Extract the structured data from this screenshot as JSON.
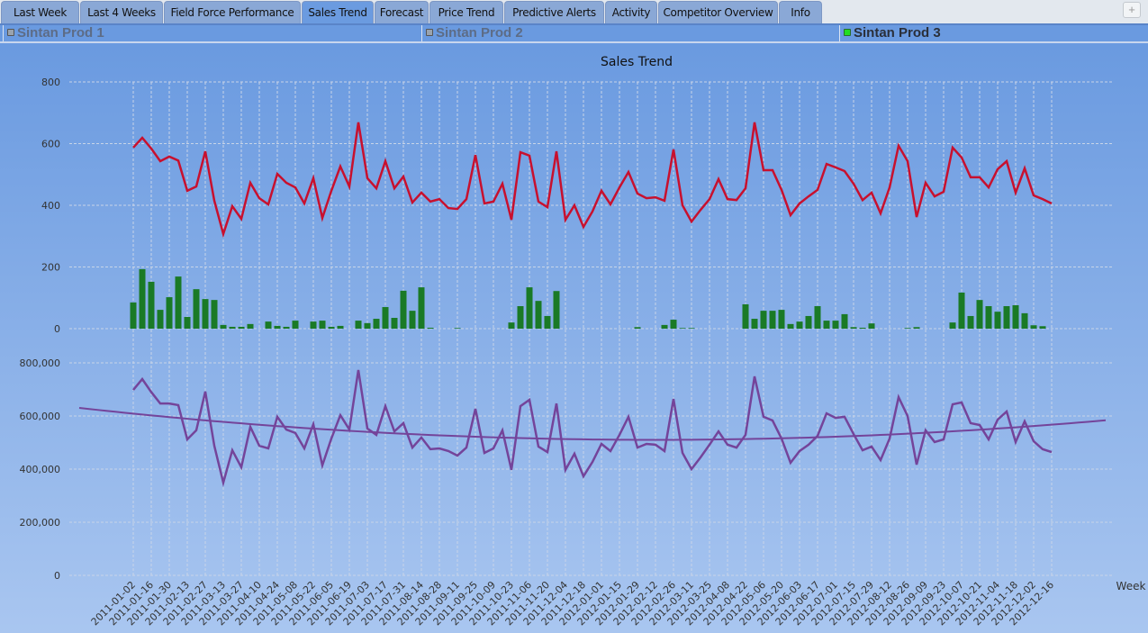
{
  "tabs": [
    {
      "label": "Last Week",
      "active": false
    },
    {
      "label": "Last 4 Weeks",
      "active": false
    },
    {
      "label": "Field Force Performance",
      "active": false
    },
    {
      "label": "Sales Trend",
      "active": true
    },
    {
      "label": "Forecast",
      "active": false
    },
    {
      "label": "Price Trend",
      "active": false
    },
    {
      "label": "Predictive Alerts",
      "active": false
    },
    {
      "label": "Activity",
      "active": false
    },
    {
      "label": "Competitor Overview",
      "active": false
    },
    {
      "label": "Info",
      "active": false
    }
  ],
  "add_tab_label": "+",
  "products": [
    {
      "label": "Sintan Prod 1",
      "selected": false
    },
    {
      "label": "Sintan Prod 2",
      "selected": false
    },
    {
      "label": "Sintan Prod 3",
      "selected": true
    }
  ],
  "colors": {
    "red_series": "#c8102e",
    "bar_series": "#1a7a26",
    "purple_series": "#74449a",
    "selected_indicator": "#22dd22"
  },
  "chart_data": [
    {
      "type": "line+bar",
      "title": "Sales Trend",
      "ylim": [
        0,
        800
      ],
      "yticks": [
        0,
        200,
        400,
        600,
        800
      ],
      "grid": true,
      "x_start": "2011-01-02",
      "x_interval_days": 7,
      "series": [
        {
          "name": "units-line",
          "type": "line",
          "color": "#c8102e",
          "values": [
            587,
            619,
            584,
            543,
            558,
            545,
            447,
            461,
            575,
            415,
            307,
            397,
            356,
            473,
            423,
            403,
            502,
            473,
            458,
            406,
            488,
            359,
            447,
            526,
            461,
            669,
            488,
            455,
            543,
            455,
            493,
            409,
            441,
            412,
            420,
            391,
            388,
            420,
            563,
            406,
            412,
            470,
            353,
            572,
            561,
            412,
            394,
            575,
            353,
            400,
            330,
            380,
            447,
            403,
            458,
            508,
            438,
            423,
            426,
            415,
            581,
            400,
            347,
            385,
            420,
            485,
            420,
            417,
            455,
            669,
            514,
            514,
            450,
            368,
            406,
            429,
            450,
            534,
            523,
            511,
            470,
            417,
            441,
            374,
            458,
            593,
            543,
            362,
            473,
            429,
            444,
            587,
            555,
            491,
            491,
            458,
            517,
            543,
            441,
            520,
            432,
            420,
            406
          ]
        },
        {
          "name": "units-bars",
          "type": "bar",
          "color": "#1a7a26",
          "values": [
            85,
            193,
            152,
            61,
            102,
            169,
            38,
            128,
            96,
            93,
            12,
            6,
            6,
            15,
            0,
            23,
            9,
            6,
            26,
            0,
            23,
            26,
            6,
            9,
            0,
            26,
            18,
            32,
            70,
            35,
            123,
            58,
            134,
            3,
            0,
            0,
            2,
            0,
            0,
            0,
            0,
            0,
            20,
            73,
            134,
            90,
            41,
            122,
            0,
            0,
            0,
            0,
            0,
            0,
            0,
            0,
            5,
            0,
            0,
            12,
            29,
            2,
            2,
            0,
            0,
            0,
            0,
            0,
            79,
            32,
            58,
            58,
            61,
            15,
            23,
            41,
            73,
            26,
            26,
            47,
            5,
            3,
            17,
            0,
            0,
            0,
            2,
            5,
            0,
            0,
            0,
            20,
            117,
            41,
            93,
            73,
            55,
            73,
            76,
            50,
            11,
            8,
            0
          ]
        }
      ]
    },
    {
      "type": "line",
      "ylim": [
        0,
        800000
      ],
      "yticks": [
        "0",
        "200,000",
        "400,000",
        "600,000",
        "800,000"
      ],
      "grid": true,
      "xlabel": "Week",
      "x_start": "2011-01-02",
      "x_interval_days": 7,
      "categories_labels": [
        "2011-01-02",
        "2011-01-16",
        "2011-01-30",
        "2011-02-13",
        "2011-02-27",
        "2011-03-13",
        "2011-03-27",
        "2011-04-10",
        "2011-04-24",
        "2011-05-08",
        "2011-05-22",
        "2011-06-05",
        "2011-06-19",
        "2011-07-03",
        "2011-07-17",
        "2011-07-31",
        "2011-08-14",
        "2011-08-28",
        "2011-09-11",
        "2011-09-25",
        "2011-10-09",
        "2011-10-23",
        "2011-11-06",
        "2011-11-20",
        "2011-12-04",
        "2011-12-18",
        "2012-01-01",
        "2012-01-15",
        "2012-01-29",
        "2012-02-12",
        "2012-02-26",
        "2012-03-11",
        "2012-03-25",
        "2012-04-08",
        "2012-04-22",
        "2012-05-06",
        "2012-05-20",
        "2012-06-03",
        "2012-06-17",
        "2012-07-01",
        "2012-07-15",
        "2012-07-29",
        "2012-08-12",
        "2012-08-26",
        "2012-09-09",
        "2012-09-23",
        "2012-10-07",
        "2012-10-21",
        "2012-11-04",
        "2012-11-18",
        "2012-12-02",
        "2012-12-16"
      ],
      "series": [
        {
          "name": "revenue",
          "color": "#74449a",
          "values": [
            698000,
            739000,
            690000,
            647000,
            647000,
            641000,
            512000,
            546000,
            692000,
            488000,
            349000,
            471000,
            407000,
            559000,
            488000,
            478000,
            597000,
            549000,
            536000,
            478000,
            569000,
            414000,
            515000,
            603000,
            549000,
            773000,
            553000,
            529000,
            637000,
            542000,
            573000,
            481000,
            519000,
            475000,
            478000,
            468000,
            451000,
            481000,
            627000,
            461000,
            478000,
            546000,
            397000,
            637000,
            661000,
            485000,
            464000,
            647000,
            397000,
            458000,
            373000,
            427000,
            495000,
            468000,
            529000,
            597000,
            481000,
            495000,
            492000,
            468000,
            664000,
            461000,
            400000,
            444000,
            492000,
            542000,
            492000,
            481000,
            529000,
            749000,
            597000,
            583000,
            515000,
            424000,
            468000,
            492000,
            525000,
            610000,
            593000,
            597000,
            532000,
            471000,
            485000,
            434000,
            515000,
            671000,
            600000,
            417000,
            546000,
            502000,
            512000,
            644000,
            651000,
            573000,
            566000,
            512000,
            586000,
            617000,
            502000,
            580000,
            505000,
            475000,
            464000
          ]
        },
        {
          "name": "trend",
          "color": "#74449a",
          "type": "trendline",
          "start_week_index": -6,
          "end_week_index": 108,
          "points": [
            [
              -6,
              624000
            ],
            [
              20,
              565000
            ],
            [
              50,
              512000
            ],
            [
              70,
              508000
            ],
            [
              90,
              535000
            ],
            [
              108,
              590000
            ]
          ]
        }
      ]
    }
  ]
}
